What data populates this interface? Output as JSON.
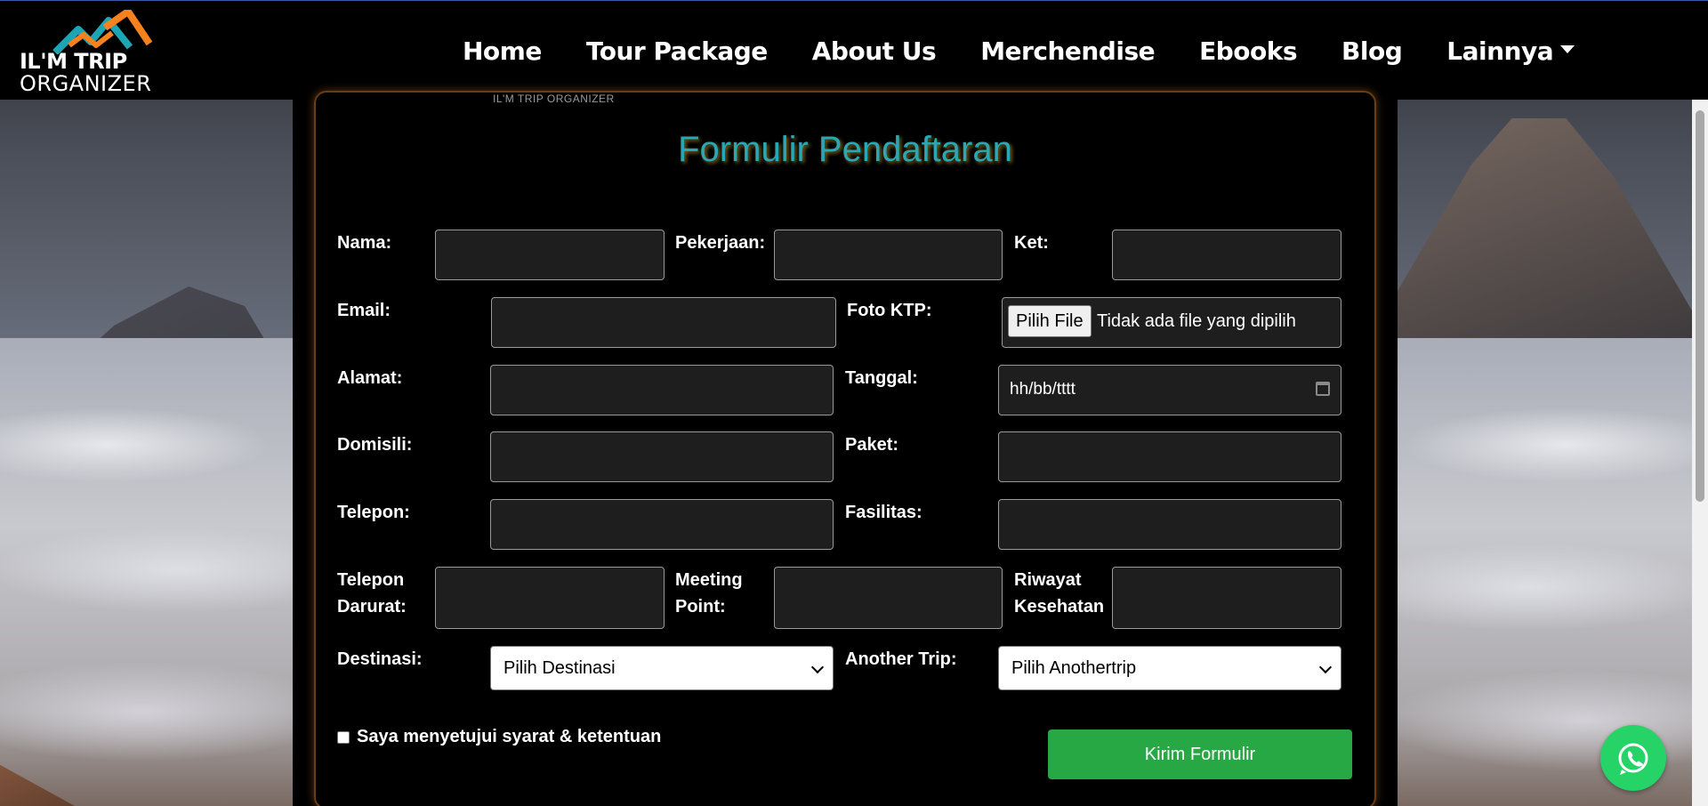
{
  "brand": {
    "logo_line1": "IL'M TRIP",
    "logo_line2": "ORGANIZER",
    "tiny_text": "IL'M TRIP ORGANIZER",
    "colors": {
      "orange": "#f5821f",
      "teal": "#1ea5b5"
    }
  },
  "nav": {
    "items": [
      "Home",
      "Tour Package",
      "About Us",
      "Merchendise",
      "Ebooks",
      "Blog",
      "Lainnya"
    ]
  },
  "form": {
    "title": "Formulir Pendaftaran",
    "labels": {
      "nama": "Nama:",
      "pekerjaan": "Pekerjaan:",
      "ket": "Ket:",
      "email": "Email:",
      "foto_ktp": "Foto KTP:",
      "alamat": "Alamat:",
      "tanggal": "Tanggal:",
      "domisili": "Domisili:",
      "paket": "Paket:",
      "telepon": "Telepon:",
      "fasilitas": "Fasilitas:",
      "telepon_darurat_1": "Telepon",
      "telepon_darurat_2": "Darurat:",
      "meeting_point_1": "Meeting",
      "meeting_point_2": "Point:",
      "riwayat_1": "Riwayat",
      "riwayat_2": "Kesehatan",
      "destinasi": "Destinasi:",
      "another_trip": "Another Trip:"
    },
    "file_button": "Pilih File",
    "file_status": "Tidak ada file yang dipilih",
    "date_placeholder": "hh/bb/tttt",
    "destinasi_selected": "Pilih Destinasi",
    "another_trip_selected": "Pilih Anothertrip",
    "agree_label": "Saya menyetujui syarat & ketentuan",
    "submit_label": "Kirim Formulir"
  }
}
